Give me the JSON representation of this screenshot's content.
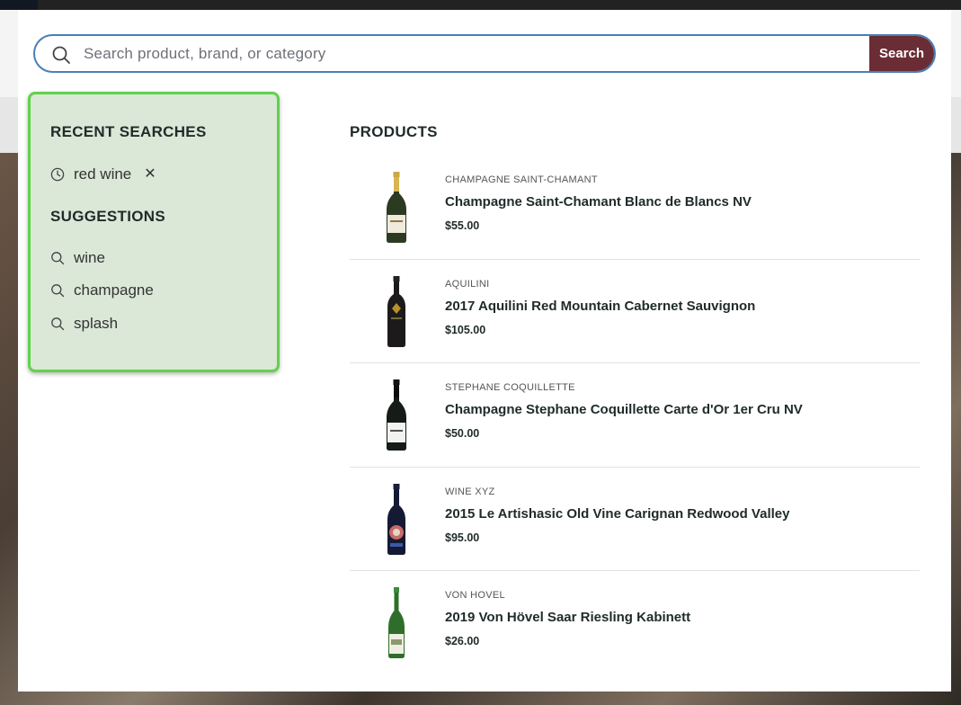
{
  "search": {
    "placeholder": "Search product, brand, or category",
    "value": "",
    "button_label": "Search"
  },
  "recent_searches": {
    "heading": "RECENT SEARCHES",
    "items": [
      {
        "label": "red wine",
        "icon": "clock-icon",
        "remove_label": "✕"
      }
    ]
  },
  "suggestions": {
    "heading": "SUGGESTIONS",
    "items": [
      {
        "label": "wine",
        "icon": "search-icon"
      },
      {
        "label": "champagne",
        "icon": "search-icon"
      },
      {
        "label": "splash",
        "icon": "search-icon"
      }
    ]
  },
  "products": {
    "heading": "PRODUCTS",
    "items": [
      {
        "brand": "CHAMPAGNE SAINT-CHAMANT",
        "name": "Champagne Saint-Chamant Blanc de Blancs NV",
        "price": "$55.00",
        "bottle": "champagne-gold"
      },
      {
        "brand": "AQUILINI",
        "name": "2017 Aquilini Red Mountain Cabernet Sauvignon",
        "price": "$105.00",
        "bottle": "red-dark"
      },
      {
        "brand": "STEPHANE COQUILLETTE",
        "name": "Champagne Stephane Coquillette Carte d'Or 1er Cru NV",
        "price": "$50.00",
        "bottle": "champagne-green"
      },
      {
        "brand": "WINE XYZ",
        "name": "2015 Le Artishasic Old Vine Carignan Redwood Valley",
        "price": "$95.00",
        "bottle": "red-blue-label"
      },
      {
        "brand": "VON HOVEL",
        "name": "2019 Von Hövel Saar Riesling Kabinett",
        "price": "$26.00",
        "bottle": "riesling-green"
      }
    ]
  },
  "colors": {
    "search_border": "#4a7fb5",
    "search_button": "#6b2d35",
    "panel_background": "#dbe8d8",
    "panel_highlight": "#5fd34a"
  }
}
